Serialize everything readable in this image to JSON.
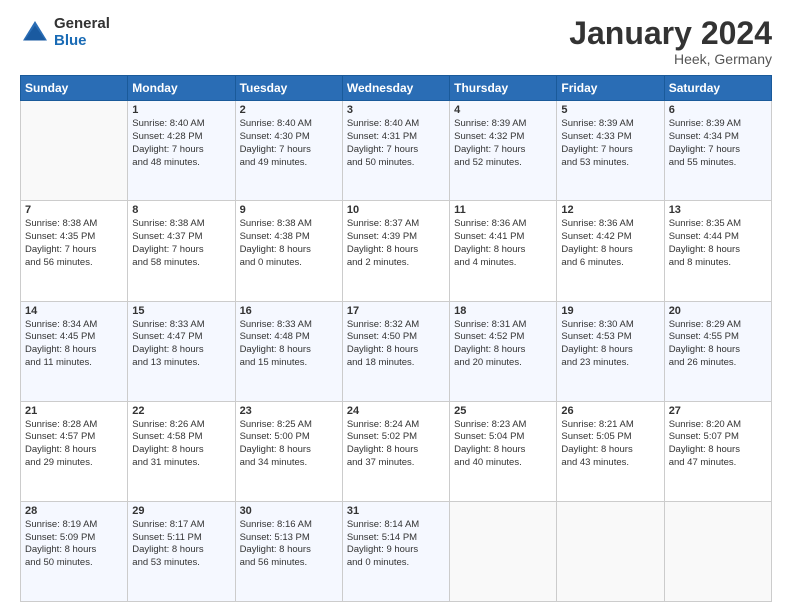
{
  "logo": {
    "general": "General",
    "blue": "Blue"
  },
  "title": "January 2024",
  "location": "Heek, Germany",
  "days_header": [
    "Sunday",
    "Monday",
    "Tuesday",
    "Wednesday",
    "Thursday",
    "Friday",
    "Saturday"
  ],
  "weeks": [
    [
      {
        "num": "",
        "info": ""
      },
      {
        "num": "1",
        "info": "Sunrise: 8:40 AM\nSunset: 4:28 PM\nDaylight: 7 hours\nand 48 minutes."
      },
      {
        "num": "2",
        "info": "Sunrise: 8:40 AM\nSunset: 4:30 PM\nDaylight: 7 hours\nand 49 minutes."
      },
      {
        "num": "3",
        "info": "Sunrise: 8:40 AM\nSunset: 4:31 PM\nDaylight: 7 hours\nand 50 minutes."
      },
      {
        "num": "4",
        "info": "Sunrise: 8:39 AM\nSunset: 4:32 PM\nDaylight: 7 hours\nand 52 minutes."
      },
      {
        "num": "5",
        "info": "Sunrise: 8:39 AM\nSunset: 4:33 PM\nDaylight: 7 hours\nand 53 minutes."
      },
      {
        "num": "6",
        "info": "Sunrise: 8:39 AM\nSunset: 4:34 PM\nDaylight: 7 hours\nand 55 minutes."
      }
    ],
    [
      {
        "num": "7",
        "info": "Sunrise: 8:38 AM\nSunset: 4:35 PM\nDaylight: 7 hours\nand 56 minutes."
      },
      {
        "num": "8",
        "info": "Sunrise: 8:38 AM\nSunset: 4:37 PM\nDaylight: 7 hours\nand 58 minutes."
      },
      {
        "num": "9",
        "info": "Sunrise: 8:38 AM\nSunset: 4:38 PM\nDaylight: 8 hours\nand 0 minutes."
      },
      {
        "num": "10",
        "info": "Sunrise: 8:37 AM\nSunset: 4:39 PM\nDaylight: 8 hours\nand 2 minutes."
      },
      {
        "num": "11",
        "info": "Sunrise: 8:36 AM\nSunset: 4:41 PM\nDaylight: 8 hours\nand 4 minutes."
      },
      {
        "num": "12",
        "info": "Sunrise: 8:36 AM\nSunset: 4:42 PM\nDaylight: 8 hours\nand 6 minutes."
      },
      {
        "num": "13",
        "info": "Sunrise: 8:35 AM\nSunset: 4:44 PM\nDaylight: 8 hours\nand 8 minutes."
      }
    ],
    [
      {
        "num": "14",
        "info": "Sunrise: 8:34 AM\nSunset: 4:45 PM\nDaylight: 8 hours\nand 11 minutes."
      },
      {
        "num": "15",
        "info": "Sunrise: 8:33 AM\nSunset: 4:47 PM\nDaylight: 8 hours\nand 13 minutes."
      },
      {
        "num": "16",
        "info": "Sunrise: 8:33 AM\nSunset: 4:48 PM\nDaylight: 8 hours\nand 15 minutes."
      },
      {
        "num": "17",
        "info": "Sunrise: 8:32 AM\nSunset: 4:50 PM\nDaylight: 8 hours\nand 18 minutes."
      },
      {
        "num": "18",
        "info": "Sunrise: 8:31 AM\nSunset: 4:52 PM\nDaylight: 8 hours\nand 20 minutes."
      },
      {
        "num": "19",
        "info": "Sunrise: 8:30 AM\nSunset: 4:53 PM\nDaylight: 8 hours\nand 23 minutes."
      },
      {
        "num": "20",
        "info": "Sunrise: 8:29 AM\nSunset: 4:55 PM\nDaylight: 8 hours\nand 26 minutes."
      }
    ],
    [
      {
        "num": "21",
        "info": "Sunrise: 8:28 AM\nSunset: 4:57 PM\nDaylight: 8 hours\nand 29 minutes."
      },
      {
        "num": "22",
        "info": "Sunrise: 8:26 AM\nSunset: 4:58 PM\nDaylight: 8 hours\nand 31 minutes."
      },
      {
        "num": "23",
        "info": "Sunrise: 8:25 AM\nSunset: 5:00 PM\nDaylight: 8 hours\nand 34 minutes."
      },
      {
        "num": "24",
        "info": "Sunrise: 8:24 AM\nSunset: 5:02 PM\nDaylight: 8 hours\nand 37 minutes."
      },
      {
        "num": "25",
        "info": "Sunrise: 8:23 AM\nSunset: 5:04 PM\nDaylight: 8 hours\nand 40 minutes."
      },
      {
        "num": "26",
        "info": "Sunrise: 8:21 AM\nSunset: 5:05 PM\nDaylight: 8 hours\nand 43 minutes."
      },
      {
        "num": "27",
        "info": "Sunrise: 8:20 AM\nSunset: 5:07 PM\nDaylight: 8 hours\nand 47 minutes."
      }
    ],
    [
      {
        "num": "28",
        "info": "Sunrise: 8:19 AM\nSunset: 5:09 PM\nDaylight: 8 hours\nand 50 minutes."
      },
      {
        "num": "29",
        "info": "Sunrise: 8:17 AM\nSunset: 5:11 PM\nDaylight: 8 hours\nand 53 minutes."
      },
      {
        "num": "30",
        "info": "Sunrise: 8:16 AM\nSunset: 5:13 PM\nDaylight: 8 hours\nand 56 minutes."
      },
      {
        "num": "31",
        "info": "Sunrise: 8:14 AM\nSunset: 5:14 PM\nDaylight: 9 hours\nand 0 minutes."
      },
      {
        "num": "",
        "info": ""
      },
      {
        "num": "",
        "info": ""
      },
      {
        "num": "",
        "info": ""
      }
    ]
  ]
}
